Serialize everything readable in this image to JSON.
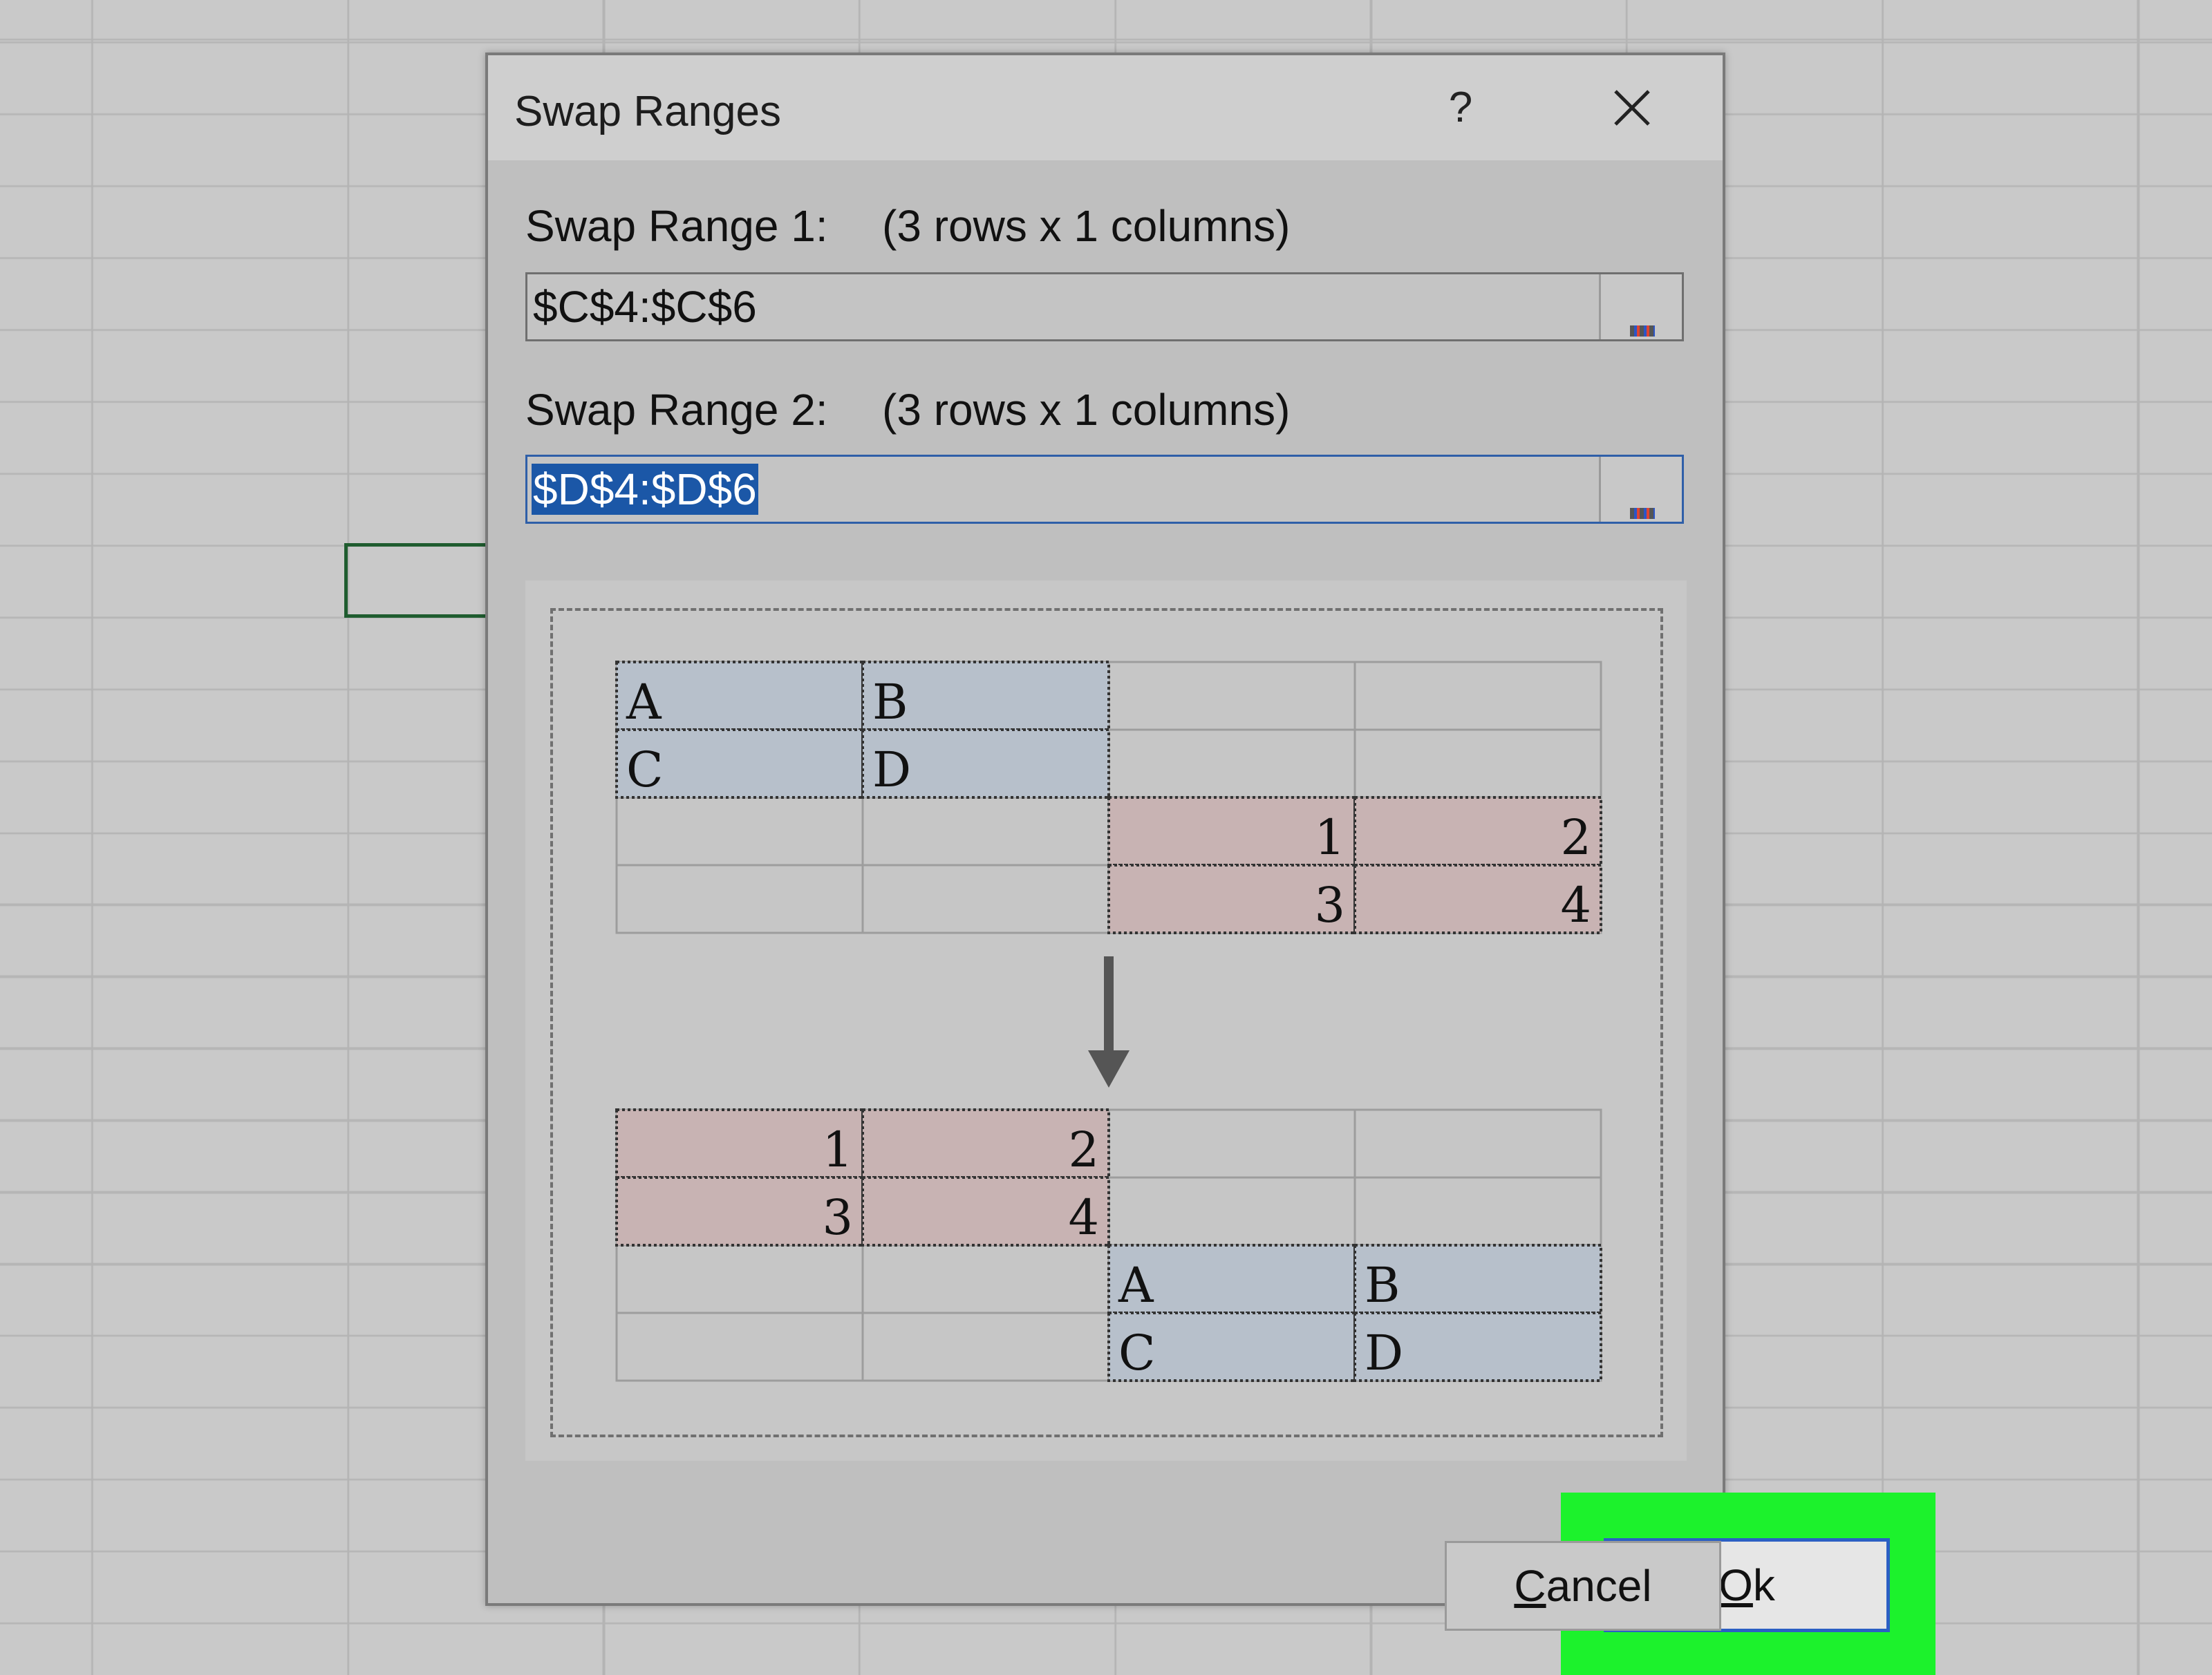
{
  "dialog": {
    "title": "Swap Ranges",
    "help": "?",
    "range1": {
      "label": "Swap Range 1:",
      "dimensions": "(3 rows x 1 columns)",
      "value": "$C$4:$C$6"
    },
    "range2": {
      "label": "Swap Range 2:",
      "dimensions": "(3 rows x 1 columns)",
      "value": "$D$4:$D$6"
    },
    "preview": {
      "before": {
        "blue": [
          "A",
          "B",
          "C",
          "D"
        ],
        "red": [
          "1",
          "2",
          "3",
          "4"
        ]
      },
      "after": {
        "red": [
          "1",
          "2",
          "3",
          "4"
        ],
        "blue": [
          "A",
          "B",
          "C",
          "D"
        ]
      }
    },
    "buttons": {
      "ok": {
        "mnemonic": "O",
        "rest": "k"
      },
      "cancel": {
        "mnemonic": "C",
        "rest": "ancel"
      }
    }
  },
  "colors": {
    "highlight": "#1cf22c",
    "selection": "#1b57a7",
    "blue_cell": "#b7c0cb",
    "red_cell": "#c8b3b3"
  }
}
